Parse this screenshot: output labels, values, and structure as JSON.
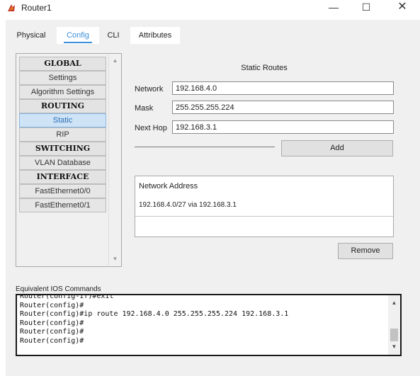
{
  "window": {
    "title": "Router1",
    "minimize_glyph": "—",
    "maximize_glyph": "☐",
    "close_glyph": "✕"
  },
  "tabs": [
    {
      "label": "Physical",
      "active": false
    },
    {
      "label": "Config",
      "active": true
    },
    {
      "label": "CLI",
      "active": false
    },
    {
      "label": "Attributes",
      "active": false
    }
  ],
  "nav": {
    "items": [
      {
        "label": "GLOBAL",
        "type": "header"
      },
      {
        "label": "Settings",
        "type": "item"
      },
      {
        "label": "Algorithm Settings",
        "type": "item"
      },
      {
        "label": "ROUTING",
        "type": "header"
      },
      {
        "label": "Static",
        "type": "item",
        "selected": true
      },
      {
        "label": "RIP",
        "type": "item"
      },
      {
        "label": "SWITCHING",
        "type": "header"
      },
      {
        "label": "VLAN Database",
        "type": "item"
      },
      {
        "label": "INTERFACE",
        "type": "header"
      },
      {
        "label": "FastEthernet0/0",
        "type": "item"
      },
      {
        "label": "FastEthernet0/1",
        "type": "item"
      }
    ]
  },
  "static_routes": {
    "title": "Static Routes",
    "network_label": "Network",
    "network_value": "192.168.4.0",
    "mask_label": "Mask",
    "mask_value": "255.255.255.224",
    "next_hop_label": "Next Hop",
    "next_hop_value": "192.168.3.1",
    "add_label": "Add",
    "table_header": "Network Address",
    "routes": [
      "192.168.4.0/27 via 192.168.3.1"
    ],
    "remove_label": "Remove"
  },
  "ios": {
    "label": "Equivalent IOS Commands",
    "lines": [
      "Router(config-if)#exit",
      "Router(config)#",
      "Router(config)#ip route 192.168.4.0 255.255.255.224 192.168.3.1",
      "Router(config)#",
      "Router(config)#",
      "Router(config)#"
    ]
  },
  "colors": {
    "accent": "#3a8fd9",
    "selected_bg": "#cfe3f7",
    "panel_bg": "#f0f0f0"
  }
}
